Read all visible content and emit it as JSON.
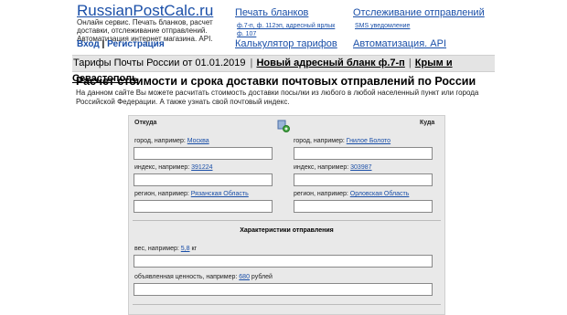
{
  "header": {
    "logo": "RussianPostCalc.ru",
    "tagline": "Онлайн сервис. Печать бланков, расчет доставки, отслеживание отправлений. Автоматизация интернет магазина. API.",
    "login": "Вход",
    "auth_sep": "|",
    "register": "Регистрация",
    "nav": {
      "print_forms": "Печать бланков",
      "print_forms_sub1": "ф.7-п, ф. 112эп, адресный ярлык",
      "print_forms_sub2": "ф. 107",
      "tracking": "Отслеживание отправлений",
      "tracking_sub": "SMS уведомление",
      "tariff_calc": "Калькулятор тарифов",
      "automation": "Автоматизация. API"
    }
  },
  "tabbar": {
    "tariffs": "Тарифы Почты России от 01.01.2019",
    "sep": "|",
    "new_form": "Новый адресный бланк ф.7-п",
    "crimea": "Крым и Севастополь"
  },
  "main": {
    "title": "Расчет стоимости и срока доставки почтовых отправлений по России",
    "intro": "На данном сайте Вы можете расчитать стоимость доставки посылки из любого в любой населенный пункт или города Российской Федерации. А также узнать свой почтовый индекс."
  },
  "form": {
    "from_header": "Откуда",
    "to_header": "Куда",
    "city_label": "город, например:",
    "from_city_example": "Москва",
    "to_city_example": "Гнилое Болото",
    "index_label": "индекс, например:",
    "from_index_example": "391224",
    "to_index_example": "303987",
    "region_label": "регион, например:",
    "from_region_example": "Рязанская Область",
    "to_region_example": "Орловская Область",
    "characteristics_header": "Характеристики отправления",
    "weight_label": "вес, например:",
    "weight_example": "5,8",
    "weight_unit": "кг",
    "value_label": "объявленная ценность, например:",
    "value_example": "680",
    "value_unit": "рублей"
  }
}
